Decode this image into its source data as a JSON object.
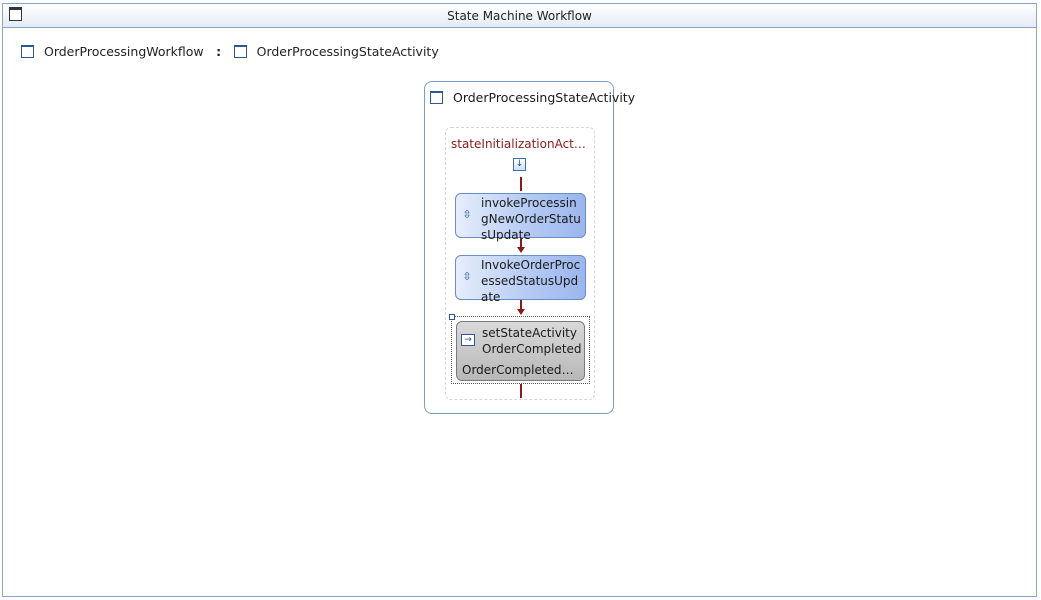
{
  "window": {
    "title": "State Machine Workflow"
  },
  "breadcrumb": {
    "workflow": "OrderProcessingWorkflow",
    "separator": ":",
    "state": "OrderProcessingStateActivity"
  },
  "state": {
    "name": "OrderProcessingStateActivity",
    "initialization": {
      "name": "stateInitializationActivit...",
      "activities": [
        {
          "label": "invokeProcessingNewOrderStatusUpdate"
        },
        {
          "label": "InvokeOrderProcessedStatusUpdate"
        }
      ],
      "set_state": {
        "label": "setStateActivityOrderCompleted",
        "target": "OrderCompletedSta..."
      }
    }
  },
  "colors": {
    "connector": "#8b1a1a",
    "border_blue": "#7d9cc4",
    "activity_blue": "#9bb6ee"
  },
  "icons": {
    "window": "window-icon",
    "workflow": "square-icon",
    "invoke": "invoke-icon",
    "set_state": "set-state-icon"
  }
}
